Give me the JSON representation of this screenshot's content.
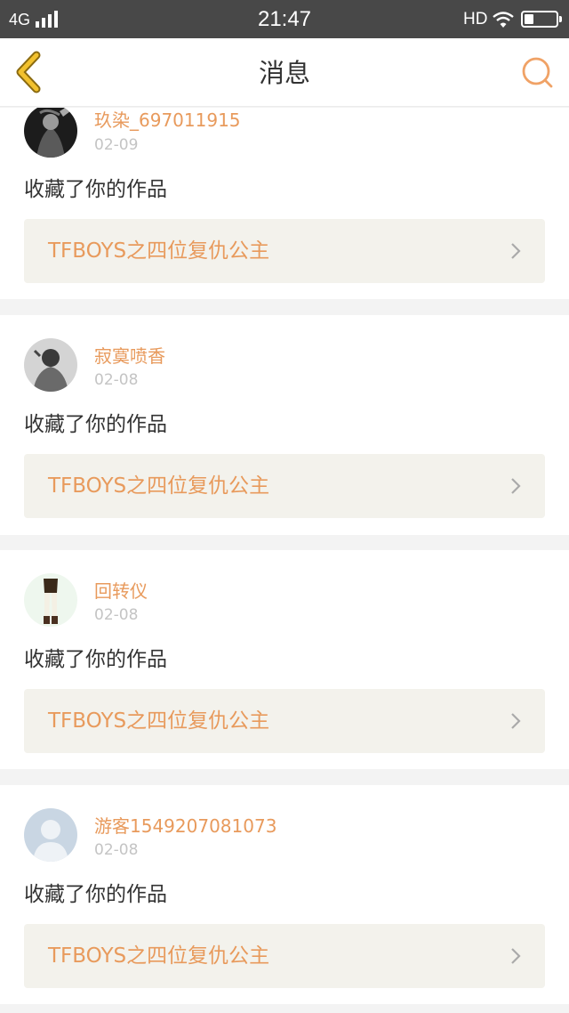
{
  "status_bar": {
    "network": "4G",
    "time": "21:47",
    "hd": "HD",
    "battery_level": 0.3
  },
  "header": {
    "title": "消息"
  },
  "colors": {
    "accent": "#e89a5c",
    "back_arrow": "#f2c12e",
    "search": "#f0a266",
    "link_bg": "#f3f2ec"
  },
  "messages": [
    {
      "username": "玖染_697011915",
      "date": "02-09",
      "action": "收藏了你的作品",
      "work_title": "TFBOYS之四位复仇公主"
    },
    {
      "username": "寂寞喷香",
      "date": "02-08",
      "action": "收藏了你的作品",
      "work_title": "TFBOYS之四位复仇公主"
    },
    {
      "username": "回转仪",
      "date": "02-08",
      "action": "收藏了你的作品",
      "work_title": "TFBOYS之四位复仇公主"
    },
    {
      "username": "游客1549207081073",
      "date": "02-08",
      "action": "收藏了你的作品",
      "work_title": "TFBOYS之四位复仇公主"
    }
  ]
}
